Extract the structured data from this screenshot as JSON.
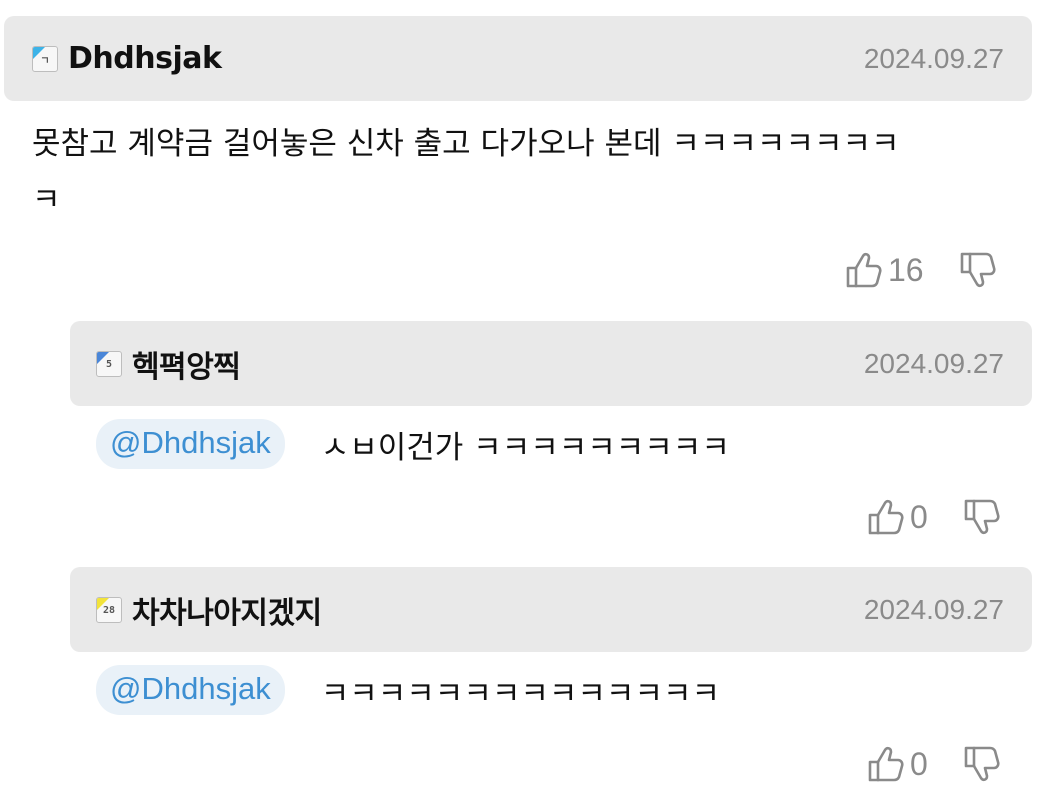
{
  "comments": [
    {
      "level_badge": "ㄱ",
      "badge_color": "#3db3e8",
      "nickname": "Dhdhsjak",
      "date": "2024.09.27",
      "text_line1": "못참고 계약금 걸어놓은 신차 출고 다가오나 본데 ㅋㅋㅋㅋㅋㅋㅋㅋ",
      "text_line2": "ㅋ",
      "likes": "16",
      "like_icon": "thumbs-up-icon",
      "dislike_icon": "thumbs-down-icon"
    }
  ],
  "replies": [
    {
      "level_badge": "5",
      "badge_color": "#4a86d8",
      "nickname": "헥펵앙찍",
      "date": "2024.09.27",
      "mention": "@Dhdhsjak",
      "text": "ㅅㅂ이건가 ㅋㅋㅋㅋㅋㅋㅋㅋㅋ",
      "likes": "0"
    },
    {
      "level_badge": "28",
      "badge_color": "#f2e33a",
      "nickname": "차차나아지겠지",
      "date": "2024.09.27",
      "mention": "@Dhdhsjak",
      "text": "ㅋㅋㅋㅋㅋㅋㅋㅋㅋㅋㅋㅋㅋㅋ",
      "likes": "0"
    }
  ],
  "colors": {
    "header_bg": "#e9e9e9",
    "mention_bg": "#e9f1f8",
    "mention_text": "#3d8fd2",
    "meta_text": "#8a8a8a"
  }
}
